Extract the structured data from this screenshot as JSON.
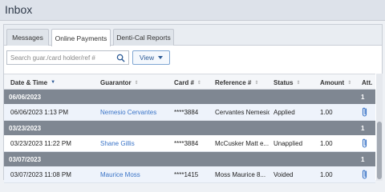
{
  "page": {
    "title": "Inbox"
  },
  "tabs": [
    {
      "label": "Messages",
      "active": false
    },
    {
      "label": "Online Payments",
      "active": true
    },
    {
      "label": "Denti-Cal Reports",
      "active": false
    }
  ],
  "toolbar": {
    "search_placeholder": "Search guar./card holder/ref #",
    "search_value": "",
    "view_label": "View"
  },
  "table": {
    "columns": [
      {
        "label": "Date & Time",
        "sort": "▼"
      },
      {
        "label": "Guarantor",
        "sort": "⇕"
      },
      {
        "label": "Card #",
        "sort": "⇕"
      },
      {
        "label": "Reference #",
        "sort": "⇕"
      },
      {
        "label": "Status",
        "sort": "⇕"
      },
      {
        "label": "Amount",
        "sort": "⇕"
      },
      {
        "label": "Att.",
        "sort": ""
      }
    ],
    "groups": [
      {
        "date": "06/06/2023",
        "count": "1",
        "rows": [
          {
            "datetime": "06/06/2023 1:13 PM",
            "guarantor": "Nemesio Cervantes",
            "card": "****3884",
            "reference": "Cervantes Nemesio",
            "status": "Applied",
            "amount": "1.00"
          }
        ]
      },
      {
        "date": "03/23/2023",
        "count": "1",
        "rows": [
          {
            "datetime": "03/23/2023 11:22 PM",
            "guarantor": "Shane Gillis",
            "card": "****3884",
            "reference": "McCusker Matt e...",
            "status": "Unapplied",
            "amount": "1.00"
          }
        ]
      },
      {
        "date": "03/07/2023",
        "count": "1",
        "rows": [
          {
            "datetime": "03/07/2023 11:08 PM",
            "guarantor": "Maurice Moss",
            "card": "****1415",
            "reference": "Moss Maurice 8...",
            "status": "Voided",
            "amount": "1.00"
          }
        ]
      }
    ]
  },
  "colors": {
    "group_bg": "#7f8792",
    "link": "#3a74c7",
    "accent": "#2d5b96",
    "row_highlight": "#eef3fb"
  },
  "icons": {
    "search": "search-icon",
    "dropdown": "chevron-down-icon",
    "attachment": "paperclip-icon"
  }
}
